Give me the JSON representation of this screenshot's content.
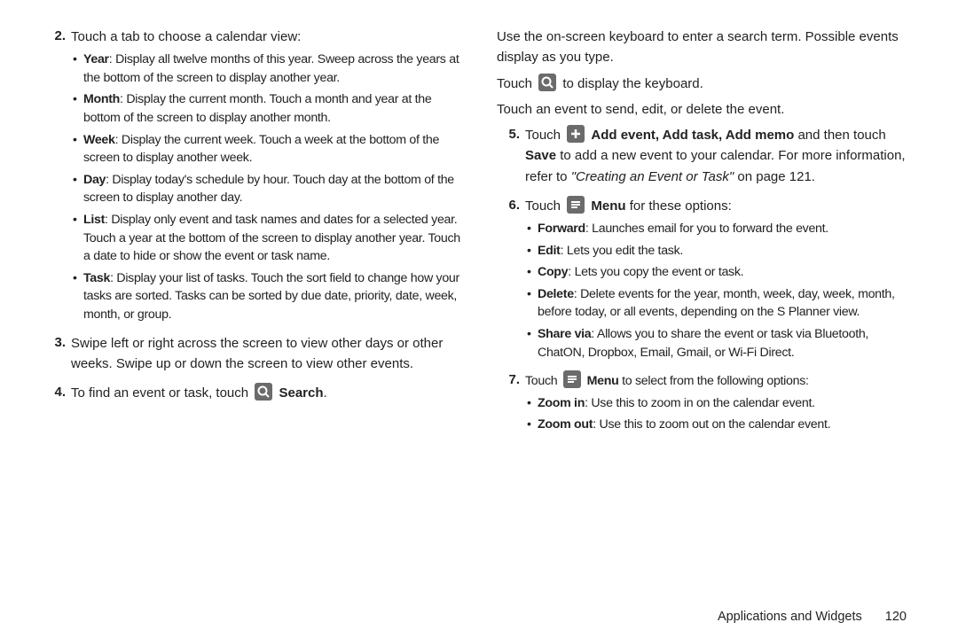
{
  "left": {
    "step2": {
      "num": "2.",
      "intro": "Touch a tab to choose a calendar view:",
      "bullets": {
        "year": {
          "label": "Year",
          "text": ": Display all twelve months of this year. Sweep across the years at the bottom of the screen to display another year."
        },
        "month": {
          "label": "Month",
          "text": ": Display the current month. Touch a month and year at the bottom of the screen to display another month."
        },
        "week": {
          "label": "Week",
          "text": ": Display the current week. Touch a week at the bottom of the screen to display another week."
        },
        "day": {
          "label": "Day",
          "text": ": Display today's schedule by hour. Touch day at the bottom of the screen to display another day."
        },
        "list": {
          "label": "List",
          "text": ": Display only event and task names and dates for a selected year. Touch a year at the bottom of the screen to display another year. Touch a date to hide or show the event or task name."
        },
        "task": {
          "label": "Task",
          "text": ": Display your list of tasks. Touch the sort field to change how your tasks are sorted. Tasks can be sorted by due date, priority, date, week, month, or group."
        }
      }
    },
    "step3": {
      "num": "3.",
      "text": "Swipe left or right across the screen to view other days or other weeks. Swipe up or down the screen to view other events."
    },
    "step4": {
      "num": "4.",
      "pre": "To find an event or task, touch ",
      "label": "Search",
      "post": "."
    }
  },
  "right": {
    "continue": {
      "line1": "Use the on-screen keyboard to enter a search term. Possible events display as you type.",
      "touch_pre": "Touch ",
      "touch_post": " to display the keyboard.",
      "line3": "Touch an event to send, edit, or delete the event."
    },
    "step5": {
      "num": "5.",
      "touch": "Touch ",
      "bold": "Add event, Add task, Add memo",
      "rest1": " and then touch ",
      "save": "Save",
      "rest2": " to add a new event to your calendar. For more information, refer to ",
      "italic": "\"Creating an Event or Task\"",
      "rest3": " on page 121."
    },
    "step6": {
      "num": "6.",
      "touch": "Touch ",
      "menu_label": "Menu",
      "after": " for these options:",
      "bullets": {
        "forward": {
          "label": "Forward",
          "text": ": Launches email for you to forward the event."
        },
        "edit": {
          "label": "Edit",
          "text": ": Lets you edit the task."
        },
        "copy": {
          "label": "Copy",
          "text": ": Lets you copy the event or task."
        },
        "delete": {
          "label": "Delete",
          "text": ": Delete events for the year, month, week, day, week, month, before today, or all events, depending on the S Planner view."
        },
        "share": {
          "label": "Share via",
          "text": ": Allows you to share the event or task via Bluetooth, ChatON, Dropbox, Email, Gmail, or Wi-Fi Direct."
        }
      }
    },
    "step7": {
      "num": "7.",
      "touch": "Touch ",
      "menu_label": "Menu",
      "after": " to select from the following options:",
      "bullets": {
        "zin": {
          "label": "Zoom in",
          "text": ": Use this to zoom in on the calendar event."
        },
        "zout": {
          "label": "Zoom out",
          "text": ": Use this to zoom out on the calendar event."
        }
      }
    }
  },
  "footer": {
    "section": "Applications and Widgets",
    "page": "120"
  }
}
